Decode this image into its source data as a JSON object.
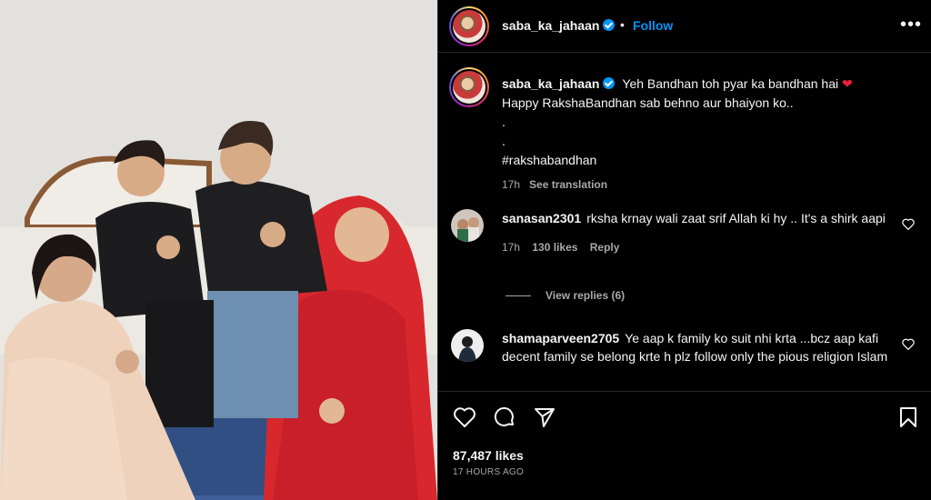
{
  "post": {
    "username": "saba_ka_jahaan",
    "follow_label": "Follow",
    "separator": "•",
    "more_label": "•••",
    "caption_lines": [
      "Yeh Bandhan toh pyar ka bandhan hai",
      "Happy RakshaBandhan sab behno aur bhaiyon ko..",
      ".",
      ".",
      "#rakshabandhan"
    ],
    "caption_emoji": "❤",
    "caption_time": "17h",
    "see_translation": "See translation",
    "likes": "87,487 likes",
    "time_ago": "17 HOURS AGO"
  },
  "comments": [
    {
      "username": "sanasan2301",
      "text": "rksha krnay wali zaat srif Allah ki hy .. It's a shirk aapi",
      "time": "17h",
      "likes": "130 likes",
      "reply": "Reply",
      "view_replies": "View replies (6)"
    },
    {
      "username": "shamaparveen2705",
      "text": "Ye aap k family ko suit nhi krta ...bcz aap kafi decent family se belong krte h plz follow only the pious religion Islam"
    }
  ],
  "icons": {
    "like": "heart-icon",
    "comment": "comment-icon",
    "share": "share-icon",
    "save": "bookmark-icon"
  },
  "colors": {
    "accent": "#0095f6",
    "background": "#000000",
    "muted_text": "#a8a8a8"
  }
}
